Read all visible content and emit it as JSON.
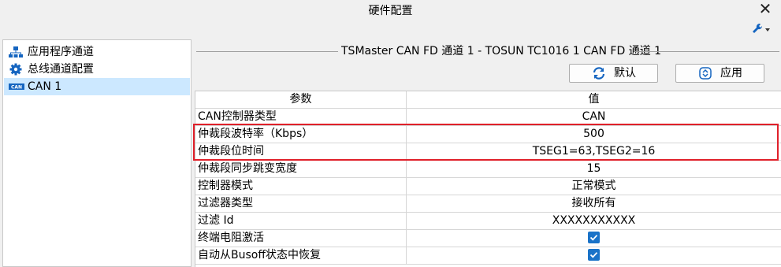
{
  "window": {
    "title": "硬件配置",
    "close_label": "✕"
  },
  "sidebar": {
    "items": [
      {
        "label": "应用程序通道",
        "icon": "network-icon",
        "selected": false
      },
      {
        "label": "总线通道配置",
        "icon": "gear-icon",
        "selected": false
      },
      {
        "label": "CAN 1",
        "icon": "can-icon",
        "selected": true
      }
    ]
  },
  "main": {
    "section_title": "TSMaster CAN FD 通道 1 - TOSUN TC1016 1 CAN FD 通道 1",
    "buttons": {
      "default_label": "默认",
      "apply_label": "应用"
    },
    "table": {
      "headers": [
        "参数",
        "值"
      ],
      "rows": [
        {
          "param": "CAN控制器类型",
          "value": "CAN"
        },
        {
          "param": "仲裁段波特率（Kbps）",
          "value": "500"
        },
        {
          "param": "仲裁段位时间",
          "value": "TSEG1=63,TSEG2=16"
        },
        {
          "param": "仲裁段同步跳变宽度",
          "value": "15"
        },
        {
          "param": "控制器模式",
          "value": "正常模式"
        },
        {
          "param": "过滤器类型",
          "value": "接收所有"
        },
        {
          "param": "过滤 Id",
          "value": "XXXXXXXXXXX"
        },
        {
          "param": "终端电阻激活",
          "value": "",
          "checked": true
        },
        {
          "param": "自动从Busoff状态中恢复",
          "value": "",
          "checked": true
        }
      ]
    }
  },
  "colors": {
    "selection": "#cce8ff",
    "checkbox": "#1a73c8",
    "highlight": "#e0202a"
  }
}
